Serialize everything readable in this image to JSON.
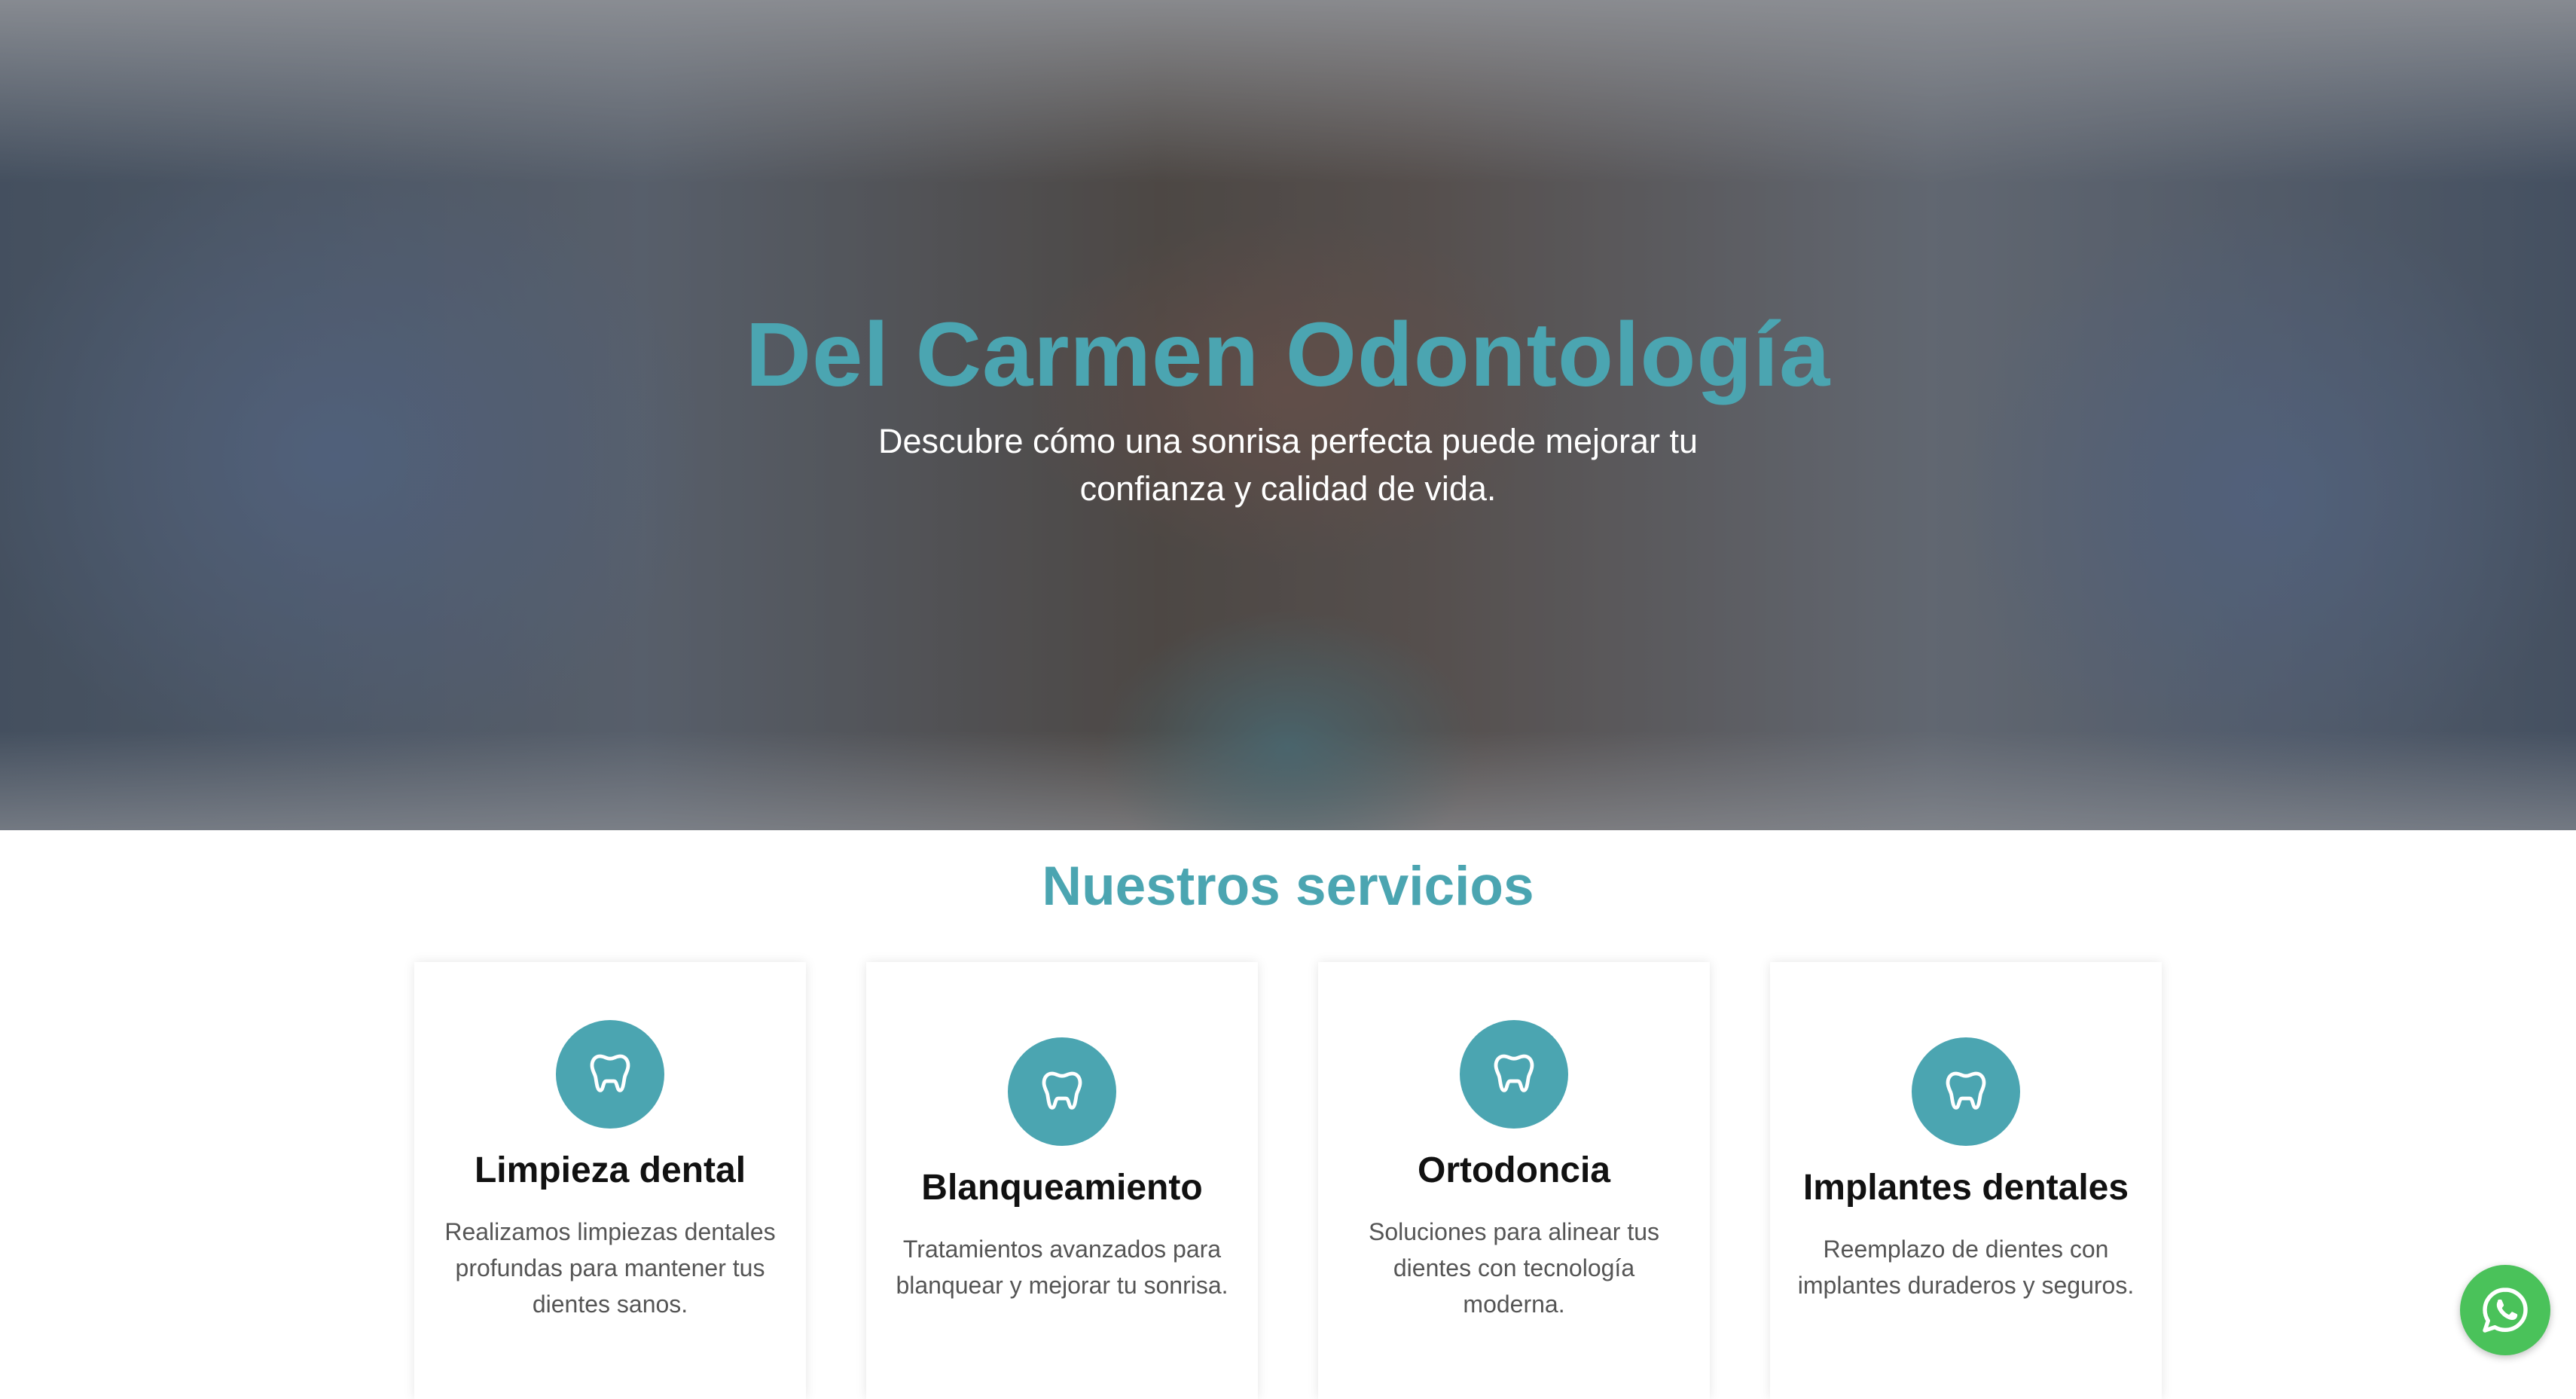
{
  "hero": {
    "title": "Del Carmen Odontología",
    "subtitle": "Descubre cómo una sonrisa perfecta puede mejorar tu confianza y calidad de vida."
  },
  "services": {
    "title": "Nuestros servicios",
    "items": [
      {
        "icon": "tooth-icon",
        "title": "Limpieza dental",
        "description": "Realizamos limpiezas dentales profundas para mantener tus dientes sanos."
      },
      {
        "icon": "tooth-icon",
        "title": "Blanqueamiento",
        "description": "Tratamientos avanzados para blanquear y mejorar tu sonrisa."
      },
      {
        "icon": "tooth-icon",
        "title": "Ortodoncia",
        "description": "Soluciones para alinear tus dientes con tecnología moderna."
      },
      {
        "icon": "tooth-icon",
        "title": "Implantes dentales",
        "description": "Reemplazo de dientes con implantes duraderos y seguros."
      }
    ]
  },
  "whatsapp": {
    "icon": "whatsapp-icon"
  },
  "colors": {
    "accent": "#4ba5b1",
    "whatsapp": "#4ac25a",
    "text": "#111111",
    "muted": "#555555"
  }
}
